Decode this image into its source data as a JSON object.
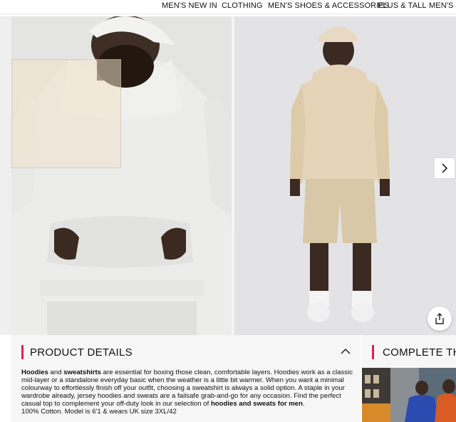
{
  "nav": {
    "items": [
      "MEN'S NEW IN",
      "CLOTHING",
      "MEN'S SHOES & ACCESSORIES",
      "PLUS & TALL",
      "MEN'S C"
    ]
  },
  "gallery": {
    "next_icon": "chevron-right-icon",
    "share_icon": "share-icon"
  },
  "details": {
    "title": "PRODUCT DETAILS",
    "collapse_icon": "chevron-up-icon",
    "p1_bold1": "Hoodies",
    "p1_t1": " and ",
    "p1_bold2": "sweatshirts",
    "p1_t2": " are essential for boxing those clean, comfortable layers. Hoodies work as a classic mid-layer or a standalone everyday basic when the weather is a little bit warmer. When you want a minimal colourway to effortlessly finish off your outfit, choosing a sweatshirt is always a solid option. A staple in your wardrobe already, jersey hoodies and sweats are a failsafe grab-and-go for any occasion. Find the perfect casual top to complement your off-duty look in our selection of ",
    "p1_bold3": "hoodies and sweats for men",
    "p1_t3": ".",
    "p2": "100% Cotton. Model is 6'1 & wears UK size 3XL/42"
  },
  "complete": {
    "title": "COMPLETE TH"
  },
  "colors": {
    "accent": "#e31b5f"
  }
}
